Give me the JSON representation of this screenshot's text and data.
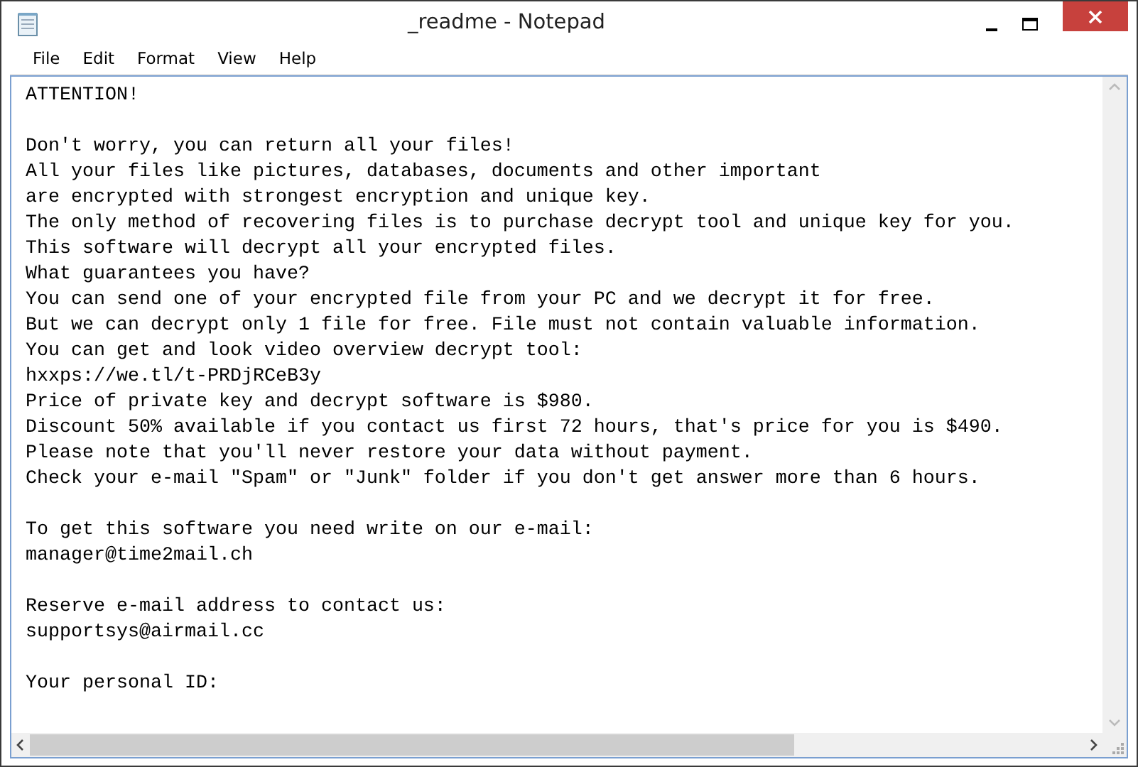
{
  "window": {
    "title": "_readme - Notepad"
  },
  "menu": [
    "File",
    "Edit",
    "Format",
    "View",
    "Help"
  ],
  "document": {
    "blocks": [
      [
        "ATTENTION!"
      ],
      [
        "Don't worry, you can return all your files!",
        "All your files like pictures, databases, documents and other important",
        "are encrypted with strongest encryption and unique key.",
        "The only method of recovering files is to purchase decrypt tool and unique key for you.",
        "This software will decrypt all your encrypted files.",
        "What guarantees you have?",
        "You can send one of your encrypted file from your PC and we decrypt it for free.",
        "But we can decrypt only 1 file for free. File must not contain valuable information.",
        "You can get and look video overview decrypt tool:",
        "hxxps://we.tl/t-PRDjRCeB3y",
        "Price of private key and decrypt software is $980.",
        "Discount 50% available if you contact us first 72 hours, that's price for you is $490.",
        "Please note that you'll never restore your data without payment.",
        "Check your e-mail \"Spam\" or \"Junk\" folder if you don't get answer more than 6 hours."
      ],
      [
        "To get this software you need write on our e-mail:",
        "manager@time2mail.ch"
      ],
      [
        "Reserve e-mail address to contact us:",
        "supportsys@airmail.cc"
      ],
      [
        "Your personal ID:"
      ]
    ]
  }
}
